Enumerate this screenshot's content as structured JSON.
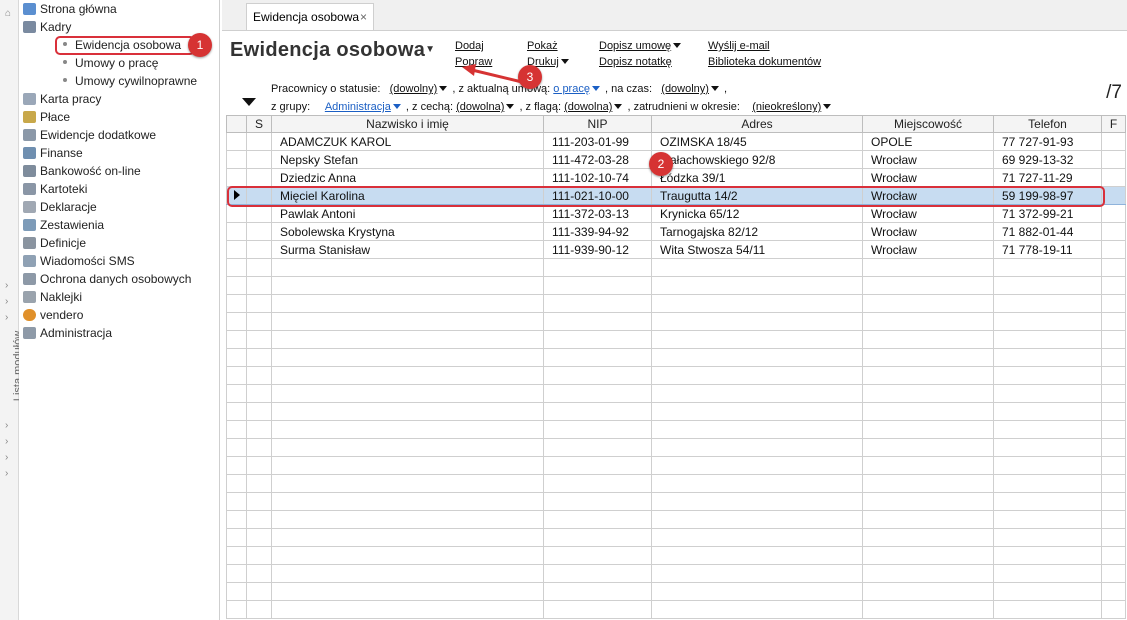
{
  "left_strip": {
    "label": "Lista modułów"
  },
  "sidebar": {
    "items": [
      {
        "label": "Strona główna",
        "icon": "home-icon"
      },
      {
        "label": "Kadry",
        "icon": "people-icon"
      },
      {
        "label": "Karta pracy",
        "icon": "card-icon"
      },
      {
        "label": "Płace",
        "icon": "money-icon"
      },
      {
        "label": "Ewidencje dodatkowe",
        "icon": "ledger-icon"
      },
      {
        "label": "Finanse",
        "icon": "finance-icon"
      },
      {
        "label": "Bankowość on-line",
        "icon": "bank-icon"
      },
      {
        "label": "Kartoteki",
        "icon": "folder-icon"
      },
      {
        "label": "Deklaracje",
        "icon": "declaration-icon"
      },
      {
        "label": "Zestawienia",
        "icon": "report-icon"
      },
      {
        "label": "Definicje",
        "icon": "definitions-icon"
      },
      {
        "label": "Wiadomości SMS",
        "icon": "sms-icon"
      },
      {
        "label": "Ochrona danych osobowych",
        "icon": "shield-icon"
      },
      {
        "label": "Naklejki",
        "icon": "label-icon"
      },
      {
        "label": "vendero",
        "icon": "gear-icon"
      },
      {
        "label": "Administracja",
        "icon": "admin-icon"
      }
    ],
    "kadry_sub": [
      {
        "label": "Ewidencja osobowa"
      },
      {
        "label": "Umowy o pracę"
      },
      {
        "label": "Umowy cywilnoprawne"
      }
    ]
  },
  "tab": {
    "label": "Ewidencja osobowa",
    "close": "×"
  },
  "header": {
    "title": "Ewidencja osobowa"
  },
  "toolbar": {
    "dodaj": "Dodaj",
    "popraw": "Popraw",
    "pokaz": "Pokaż",
    "drukuj": "Drukuj",
    "dopisz_umowe": "Dopisz umowę",
    "dopisz_notatke": "Dopisz notatkę",
    "wyslij_email": "Wyślij e-mail",
    "biblioteka": "Biblioteka dokumentów"
  },
  "filters": {
    "line1_a": "Pracownicy o statusie:",
    "status": "(dowolny)",
    "line1_b": ", z aktualną umową:",
    "umowa": "o pracę",
    "line1_c": ", na czas:",
    "czas": "(dowolny)",
    "line1_d": ",",
    "line2_a": "z grupy:",
    "grupa": "Administracja",
    "line2_b": ", z cechą:",
    "cecha": "(dowolna)",
    "line2_c": ", z flagą:",
    "flaga": "(dowolna)",
    "line2_d": ", zatrudnieni w okresie:",
    "okres": "(nieokreślony)"
  },
  "record_count": "/7",
  "table": {
    "headers": [
      "",
      "S",
      "Nazwisko i imię",
      "NIP",
      "Adres",
      "Miejscowość",
      "Telefon",
      "F"
    ],
    "rows": [
      [
        "",
        "",
        "ADAMCZUK KAROL",
        "111-203-01-99",
        "OZIMSKA 18/45",
        "OPOLE",
        "77 727-91-93",
        ""
      ],
      [
        "",
        "",
        "Nepsky Stefan",
        "111-472-03-28",
        "Małachowskiego 92/8",
        "Wrocław",
        "69 929-13-32",
        ""
      ],
      [
        "",
        "",
        "Dziedzic Anna",
        "111-102-10-74",
        "Łódzka 39/1",
        "Wrocław",
        "71 727-11-29",
        ""
      ],
      [
        "",
        "",
        "Mięciel Karolina",
        "111-021-10-00",
        "Traugutta 14/2",
        "Wrocław",
        "59 199-98-97",
        ""
      ],
      [
        "",
        "",
        "Pawlak Antoni",
        "111-372-03-13",
        "Krynicka 65/12",
        "Wrocław",
        "71 372-99-21",
        ""
      ],
      [
        "",
        "",
        "Sobolewska Krystyna",
        "111-339-94-92",
        "Tarnogajska 82/12",
        "Wrocław",
        "71 882-01-44",
        ""
      ],
      [
        "",
        "",
        "Surma Stanisław",
        "111-939-90-12",
        "Wita Stwosza 54/11",
        "Wrocław",
        "71 778-19-11",
        ""
      ]
    ],
    "selected_row": 3,
    "empty_rows": 20
  },
  "annotations": {
    "b1": "1",
    "b2": "2",
    "b3": "3"
  },
  "colors": {
    "accent_red": "#d9303a",
    "selection": "#c7dcf1",
    "link_blue": "#1b5fc4"
  }
}
